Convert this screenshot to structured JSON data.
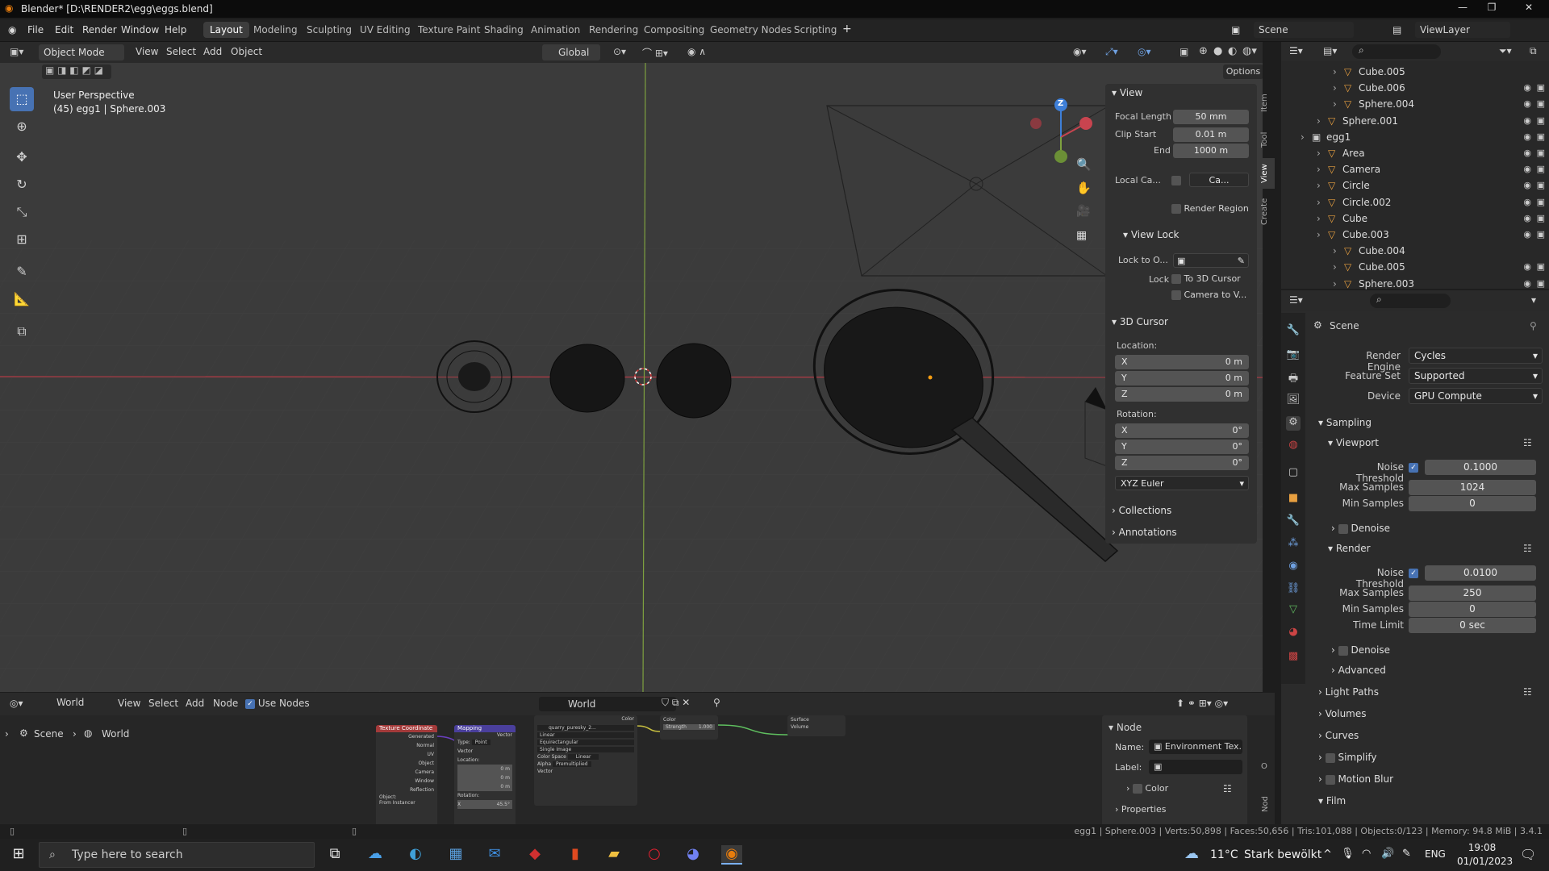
{
  "window": {
    "title": "Blender* [D:\\RENDER2\\egg\\eggs.blend]",
    "min": "—",
    "max": "❐",
    "close": "✕"
  },
  "menu": [
    "File",
    "Edit",
    "Render",
    "Window",
    "Help"
  ],
  "workspaces": [
    "Layout",
    "Modeling",
    "Sculpting",
    "UV Editing",
    "Texture Paint",
    "Shading",
    "Animation",
    "Rendering",
    "Compositing",
    "Geometry Nodes",
    "Scripting"
  ],
  "active_workspace": "Layout",
  "scene_name": "Scene",
  "view_layer": "ViewLayer",
  "viewport_header": {
    "mode": "Object Mode",
    "menus": [
      "View",
      "Select",
      "Add",
      "Object"
    ],
    "orientation": "Global",
    "options": "Options"
  },
  "viewport": {
    "perspective": "User Perspective",
    "object_info": "(45) egg1 | Sphere.003"
  },
  "gizmo": {
    "z": "Z"
  },
  "npanel": {
    "tabs": [
      "Item",
      "Tool",
      "View",
      "Create"
    ],
    "view_header": "View",
    "focal_length_label": "Focal Length",
    "focal_length": "50 mm",
    "clip_start_label": "Clip Start",
    "clip_start": "0.01 m",
    "end_label": "End",
    "end": "1000 m",
    "local_camera_label": "Local Ca...",
    "local_camera_value": "Ca...",
    "render_region": "Render Region",
    "view_lock_header": "View Lock",
    "lock_to_object_label": "Lock to O...",
    "lock_label": "Lock",
    "to_3d_cursor": "To 3D Cursor",
    "camera_to_view": "Camera to V...",
    "cursor_header": "3D Cursor",
    "location_label": "Location:",
    "loc_x": "0 m",
    "loc_y": "0 m",
    "loc_z": "0 m",
    "rotation_label": "Rotation:",
    "rot_x": "0°",
    "rot_y": "0°",
    "rot_z": "0°",
    "rotation_mode": "XYZ Euler",
    "collections": "Collections",
    "annotations": "Annotations",
    "axis_x": "X",
    "axis_y": "Y",
    "axis_z": "Z"
  },
  "outliner": {
    "rows": [
      {
        "name": "Cube.005",
        "indent": 3,
        "eye": false
      },
      {
        "name": "Cube.006",
        "indent": 3,
        "eye": true
      },
      {
        "name": "Sphere.004",
        "indent": 3,
        "eye": true
      },
      {
        "name": "Sphere.001",
        "indent": 2,
        "eye": true
      },
      {
        "name": "egg1",
        "indent": 1,
        "eye": true
      },
      {
        "name": "Area",
        "indent": 2,
        "eye": true
      },
      {
        "name": "Camera",
        "indent": 2,
        "eye": true
      },
      {
        "name": "Circle",
        "indent": 2,
        "eye": true
      },
      {
        "name": "Circle.002",
        "indent": 2,
        "eye": true
      },
      {
        "name": "Cube",
        "indent": 2,
        "eye": true
      },
      {
        "name": "Cube.003",
        "indent": 2,
        "eye": true
      },
      {
        "name": "Cube.004",
        "indent": 3,
        "eye": false
      },
      {
        "name": "Cube.005",
        "indent": 3,
        "eye": true
      },
      {
        "name": "Sphere.003",
        "indent": 3,
        "eye": true
      }
    ]
  },
  "properties": {
    "context": "Scene",
    "render_engine_label": "Render Engine",
    "render_engine": "Cycles",
    "feature_set_label": "Feature Set",
    "feature_set": "Supported",
    "device_label": "Device",
    "device": "GPU Compute",
    "sampling": "Sampling",
    "viewport": "Viewport",
    "vp_noise_threshold_label": "Noise Threshold",
    "vp_noise_threshold": "0.1000",
    "vp_max_samples_label": "Max Samples",
    "vp_max_samples": "1024",
    "vp_min_samples_label": "Min Samples",
    "vp_min_samples": "0",
    "vp_denoise": "Denoise",
    "render": "Render",
    "r_noise_threshold_label": "Noise Threshold",
    "r_noise_threshold": "0.0100",
    "r_max_samples_label": "Max Samples",
    "r_max_samples": "250",
    "r_min_samples_label": "Min Samples",
    "r_min_samples": "0",
    "r_time_limit_label": "Time Limit",
    "r_time_limit": "0 sec",
    "r_denoise": "Denoise",
    "advanced": "Advanced",
    "light_paths": "Light Paths",
    "volumes": "Volumes",
    "curves": "Curves",
    "simplify": "Simplify",
    "motion_blur": "Motion Blur",
    "film": "Film"
  },
  "node_editor": {
    "type": "World",
    "menus": [
      "View",
      "Select",
      "Add",
      "Node"
    ],
    "use_nodes": "Use Nodes",
    "world_name": "World",
    "breadcrumb_scene": "Scene",
    "breadcrumb_world": "World",
    "side_node_header": "Node",
    "name_label": "Name:",
    "name_value": "Environment Tex...",
    "label_label": "Label:",
    "color": "Color",
    "properties": "Properties",
    "nodes": {
      "texcoord": {
        "title": "Texture Coordinate",
        "outputs": [
          "Generated",
          "Normal",
          "UV",
          "Object",
          "Camera",
          "Window",
          "Reflection"
        ],
        "object": "Object:",
        "instancer": "From Instancer"
      },
      "mapping": {
        "title": "Mapping",
        "out": "Vector",
        "type_label": "Type:",
        "type": "Point",
        "vector": "Vector",
        "location": "Location:",
        "x": "0 m",
        "y": "0 m",
        "z": "0 m",
        "rotation": "Rotation:",
        "rx": "X",
        "rx_val": "45.5°"
      },
      "envtex": {
        "file": "quarry_puresky_2...",
        "color_out": "Color",
        "linear": "Linear",
        "equirect": "Equirectangular",
        "single": "Single Image",
        "cs_label": "Color Space",
        "cs": "Linear",
        "alpha_label": "Alpha",
        "alpha": "Premultiplied",
        "vector": "Vector"
      },
      "background": {
        "color": "Color",
        "strength_label": "Strength",
        "strength": "1.000"
      },
      "output": {
        "surface": "Surface",
        "volume": "Volume"
      }
    }
  },
  "status": {
    "text": "egg1 | Sphere.003 | Verts:50,898 | Faces:50,656 | Tris:101,088 | Objects:0/123 | Memory: 94.8 MiB | 3.4.1"
  },
  "taskbar": {
    "search_placeholder": "Type here to search",
    "weather_temp": "11°C",
    "weather_text": "Stark bewölkt",
    "lang": "ENG",
    "time": "19:08",
    "date": "01/01/2023"
  },
  "colors": {
    "accent": "#4772b3",
    "x_axis": "#c8444f",
    "y_axis": "#7ea13f",
    "z_axis": "#3e7fd8"
  }
}
